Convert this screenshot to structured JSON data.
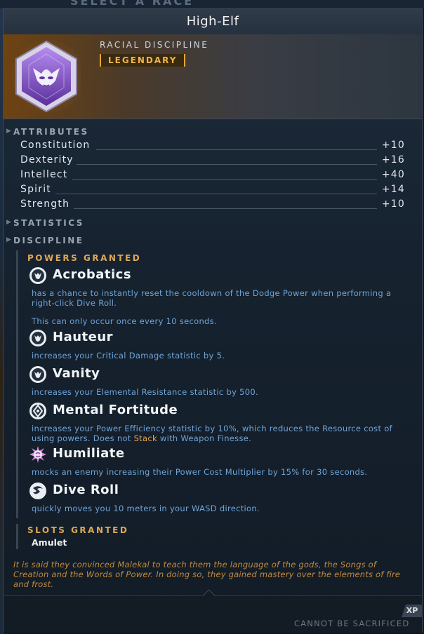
{
  "background": {
    "title_fragment": "SELECT A RACE"
  },
  "window": {
    "title": "High-Elf"
  },
  "header": {
    "discipline_type": "RACIAL DISCIPLINE",
    "rarity": "LEGENDARY",
    "rarity_color": "#f0b34a",
    "emblem_icon": "elf-mask-emblem-icon"
  },
  "attributes": {
    "header": "ATTRIBUTES",
    "items": [
      {
        "name": "Constitution",
        "value": "+10"
      },
      {
        "name": "Dexterity",
        "value": "+16"
      },
      {
        "name": "Intellect",
        "value": "+40"
      },
      {
        "name": "Spirit",
        "value": "+14"
      },
      {
        "name": "Strength",
        "value": "+10"
      }
    ]
  },
  "statistics": {
    "header": "STATISTICS"
  },
  "discipline": {
    "header": "DISCIPLINE",
    "powers_header": "POWERS GRANTED",
    "powers": [
      {
        "name": "Acrobatics",
        "icon": "ability-badge-icon",
        "desc": "has a chance to instantly reset the cooldown of the Dodge Power when performing a right-click Dive Roll.",
        "desc2": "This can only occur once every 10 seconds."
      },
      {
        "name": "Hauteur",
        "icon": "ability-badge-icon",
        "desc": "increases your Critical Damage statistic by 5."
      },
      {
        "name": "Vanity",
        "icon": "ability-badge-icon",
        "desc": "increases your Elemental Resistance statistic by 500."
      },
      {
        "name": "Mental Fortitude",
        "icon": "diamond-badge-icon",
        "desc_pre": "increases your Power Efficiency statistic by 10%, which reduces the Resource cost of using powers. Does not ",
        "desc_hl": "Stack",
        "desc_post": " with Weapon Finesse."
      },
      {
        "name": "Humiliate",
        "icon": "taunt-burst-icon",
        "desc": "mocks an enemy increasing their Power Cost Multiplier by 15% for 30 seconds."
      },
      {
        "name": "Dive Roll",
        "icon": "dive-roll-icon",
        "desc": "quickly moves you 10 meters in your WASD direction."
      }
    ],
    "slots_header": "SLOTS GRANTED",
    "slots": [
      "Amulet"
    ]
  },
  "lore": "It is said they convinced Malekal to teach them the language of the gods, the Songs of Creation and the Words of Power. In doing so, they gained mastery over the elements of fire and frost.",
  "footer": {
    "status": "CANNOT BE SACRIFICED",
    "xp_badge": "XP"
  }
}
